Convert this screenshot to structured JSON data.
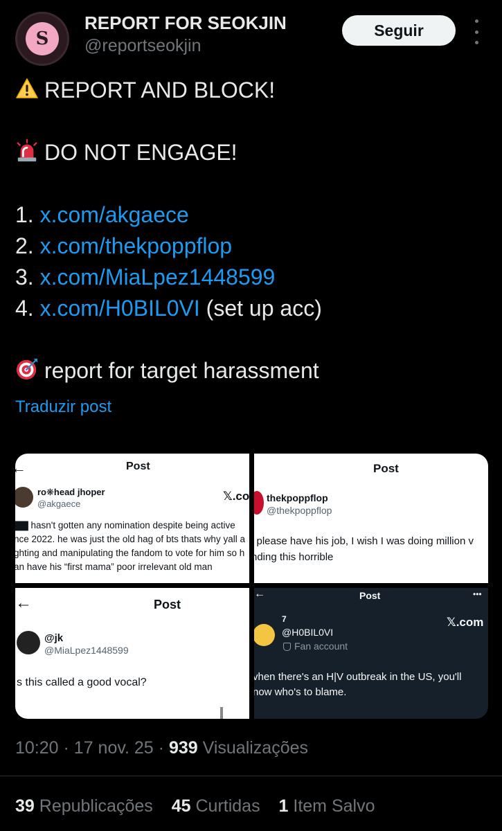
{
  "author": {
    "display_name": "REPORT FOR SEOKJIN",
    "handle": "@reportseokjin",
    "avatar_label": "S"
  },
  "follow_label": "Seguir",
  "body": {
    "line1": "REPORT AND BLOCK!",
    "line2": "DO NOT ENGAGE!",
    "items": [
      {
        "num": "1.",
        "link": "x.com/akgaece",
        "suffix": ""
      },
      {
        "num": "2.",
        "link": "x.com/thekpoppflop",
        "suffix": ""
      },
      {
        "num": "3.",
        "link": "x.com/MiaLpez1448599",
        "suffix": ""
      },
      {
        "num": "4.",
        "link": "x.com/H0BIL0VI",
        "suffix": "(set up acc)"
      }
    ],
    "line_last": "report for target harassment"
  },
  "translate_label": "Traduzir post",
  "icons": {
    "warning": "warning-icon",
    "siren": "siren-icon",
    "target": "target-icon"
  },
  "media": [
    {
      "header": "Post",
      "name": "ro❋head jhoper",
      "handle": "@akgaece",
      "brand": "𝕏.co",
      "lines": [
        "▇▇ hasn't gotten any nomination despite being active",
        "nce 2022.  he was just the old hag of bts thats why yall a",
        "ghting and manipulating the fandom to vote for him so h",
        "an have his “first mama” poor irrelevant old man"
      ]
    },
    {
      "header": "Post",
      "name": "thekpoppflop",
      "handle": "@thekpoppflop",
      "lines": [
        "l please have his job, I wish I was doing million v",
        "nding this horrible"
      ]
    },
    {
      "header": "Post",
      "name": "@jk",
      "handle": "@MiaLpez1448599",
      "lines": [
        "s this called a good vocal?"
      ]
    },
    {
      "header": "Post",
      "name": "7",
      "handle": "@H0BIL0VI",
      "badge": "Fan account",
      "brand": "𝕏.com",
      "more": "•••",
      "lines": [
        "vhen there's an H|V outbreak in the US, you'll",
        "now who's to blame."
      ]
    }
  ],
  "meta": {
    "time": "10:20",
    "sep": "·",
    "date": "17 nov. 25",
    "views_count": "939",
    "views_label": "Visualizações"
  },
  "stats": {
    "reposts_count": "39",
    "reposts_label": "Republicações",
    "likes_count": "45",
    "likes_label": "Curtidas",
    "saves_count": "1",
    "saves_label": "Item Salvo"
  }
}
